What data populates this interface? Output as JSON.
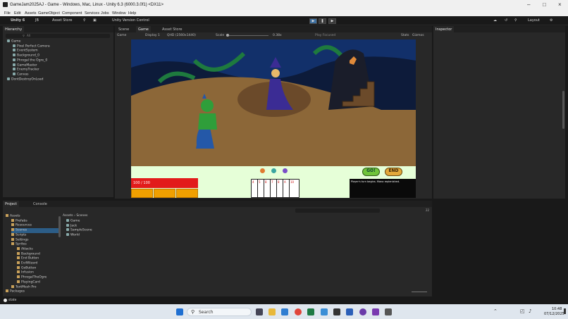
{
  "window": {
    "title": "GameJam2025AJ - Game - Windows, Mac, Linux - Unity 6.3 (6000.3.0f1) <DX11>"
  },
  "menu": [
    "File",
    "Edit",
    "Assets",
    "GameObject",
    "Component",
    "Services",
    "Jobs",
    "Window",
    "Help"
  ],
  "toolbar": {
    "account": "Unity 6",
    "user": "JB",
    "asset_store": "Asset Store",
    "version_control": "Unity Version Control",
    "layout": "Layout"
  },
  "hierarchy": {
    "tab": "Hierarchy",
    "search_placeholder": "All",
    "items": [
      {
        "label": "Game",
        "depth": 0
      },
      {
        "label": "Pixel Perfect Camera",
        "depth": 1
      },
      {
        "label": "EventSystem",
        "depth": 1
      },
      {
        "label": "Background_0",
        "depth": 1
      },
      {
        "label": "Phrogal the Ogre_0",
        "depth": 1
      },
      {
        "label": "GameMaster",
        "depth": 1
      },
      {
        "label": "EnemyTracker",
        "depth": 1
      },
      {
        "label": "Canvas",
        "depth": 1
      },
      {
        "label": "DontDestroyOnLoad",
        "depth": 0
      }
    ]
  },
  "scene_tabs": [
    "Scene",
    "Game",
    "Asset Store"
  ],
  "game_bar": {
    "mode": "Game",
    "display": "Display 1",
    "resolution": "QHD (2560x1440)",
    "scale_label": "Scale",
    "scale_value": "0.38x",
    "play_focused": "Play Focused",
    "stats": "Stats",
    "gizmos": "Gizmos"
  },
  "game_ui": {
    "health_text": "100 / 100",
    "log_text": "Player's turn begins. Mana replenished.",
    "go_button": "GO!",
    "end_button": "END",
    "cards": [
      "4",
      "5",
      "8",
      "7",
      "8",
      "A",
      "10"
    ],
    "health_color": "#e21b1b",
    "mana_color": "#f0a000"
  },
  "inspector": {
    "tab": "Inspector"
  },
  "project": {
    "tabs": [
      "Project",
      "Console"
    ],
    "breadcrumb": [
      "Assets",
      "Scenes"
    ],
    "zoom_count": "22",
    "tree": [
      {
        "label": "Assets",
        "depth": 0
      },
      {
        "label": "Prefabs",
        "depth": 1
      },
      {
        "label": "Resources",
        "depth": 1
      },
      {
        "label": "Scenes",
        "depth": 1
      },
      {
        "label": "Scripts",
        "depth": 1
      },
      {
        "label": "Settings",
        "depth": 1
      },
      {
        "label": "Sprites",
        "depth": 1
      },
      {
        "label": "Attacks",
        "depth": 2
      },
      {
        "label": "Background",
        "depth": 2
      },
      {
        "label": "End Button",
        "depth": 2
      },
      {
        "label": "EvilWizard",
        "depth": 2
      },
      {
        "label": "GoButton",
        "depth": 2
      },
      {
        "label": "Infusion",
        "depth": 2
      },
      {
        "label": "PhrogalTheOgre",
        "depth": 2
      },
      {
        "label": "PlayingCard",
        "depth": 2
      },
      {
        "label": "TextMesh Pro",
        "depth": 1
      },
      {
        "label": "Packages",
        "depth": 0
      }
    ],
    "files": [
      "Game",
      "Jack",
      "SampleScene",
      "World"
    ]
  },
  "statusbar": {
    "text": "state"
  },
  "taskbar": {
    "search_placeholder": "Search",
    "time": "10:48",
    "date": "07/12/2025"
  }
}
